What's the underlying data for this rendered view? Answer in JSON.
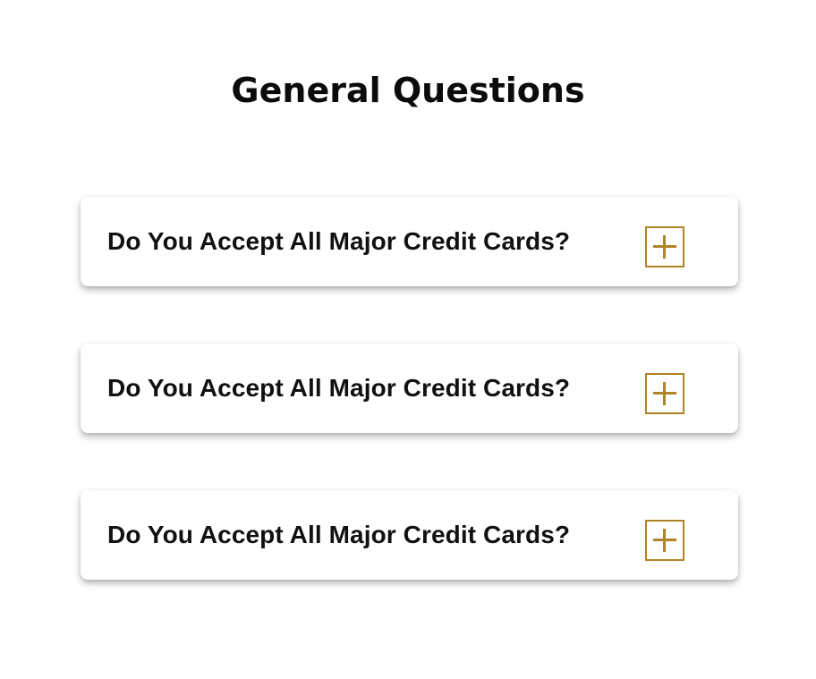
{
  "section": {
    "title": "General Questions"
  },
  "faq": {
    "items": [
      {
        "question": "Do You Accept All Major Credit Cards?",
        "icon": "plus-icon",
        "expanded": false
      },
      {
        "question": "Do You Accept All Major Credit Cards?",
        "icon": "plus-icon",
        "expanded": false
      },
      {
        "question": "Do You Accept All Major Credit Cards?",
        "icon": "plus-icon",
        "expanded": false
      }
    ]
  },
  "colors": {
    "accent": "#b08328",
    "text": "#111111",
    "background": "#ffffff"
  }
}
